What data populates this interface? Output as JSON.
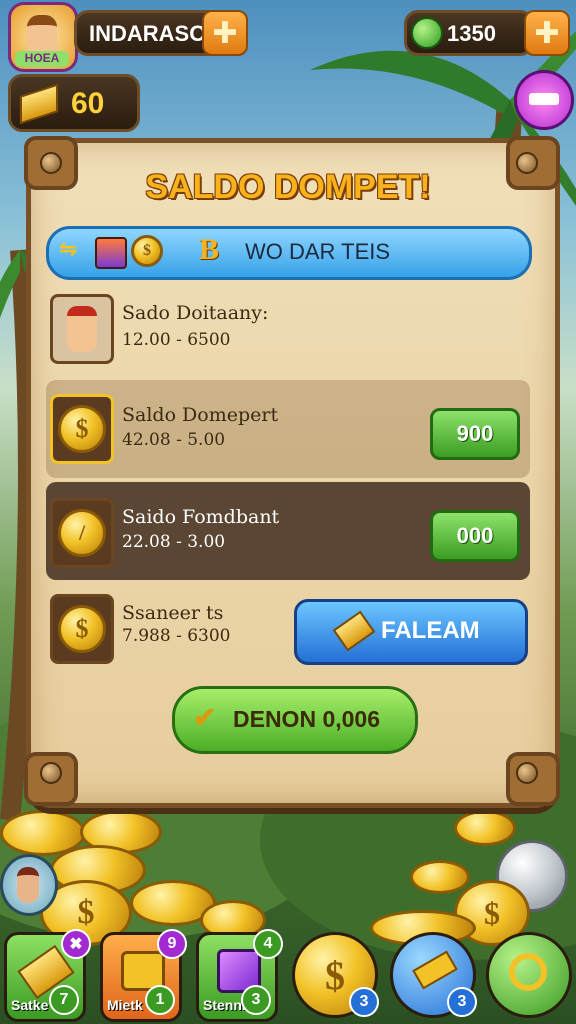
{
  "top_bar": {
    "player_name": "INDARASO",
    "badge_label": "HOEA",
    "gems": "1350",
    "energy": "60"
  },
  "panel": {
    "title": "SALDO DOMPET!",
    "tab_bar_label": "WO DAR TEIS",
    "rows": [
      {
        "name": "Sado Doitaany:",
        "value": "12.00 - 6500",
        "button": ""
      },
      {
        "name": "Saldo Domepert",
        "value": "42.08 - 5.00",
        "button": "900"
      },
      {
        "name": "Saido Fomdbant",
        "value": "22.08 - 3.00",
        "button": "000"
      },
      {
        "name": "Ssaneer ts",
        "value": "7.988 - 6300",
        "button": "FALEAM"
      }
    ],
    "main_button": "DENON 0,006"
  },
  "bottom_bar": [
    {
      "label": "Satke",
      "count": "7",
      "corner_badge": ""
    },
    {
      "label": "Mietk",
      "count": "1",
      "corner_badge": "9"
    },
    {
      "label": "Stennrx",
      "count": "3",
      "corner_badge": "4"
    },
    {
      "label": "",
      "count": "3",
      "corner_badge": ""
    },
    {
      "label": "",
      "count": "3",
      "corner_badge": ""
    },
    {
      "label": "",
      "count": "",
      "corner_badge": ""
    }
  ],
  "colors": {
    "panel_title": "#f7b21c",
    "green_button": "#4cae26",
    "blue_button": "#2470d6"
  },
  "icons": [
    "avatar-icon",
    "plus-icon",
    "gem-icon",
    "gold-bar-icon",
    "paintbrush-icon",
    "coin-icon",
    "chest-icon",
    "cube-icon",
    "hammer-icon",
    "search-icon"
  ]
}
